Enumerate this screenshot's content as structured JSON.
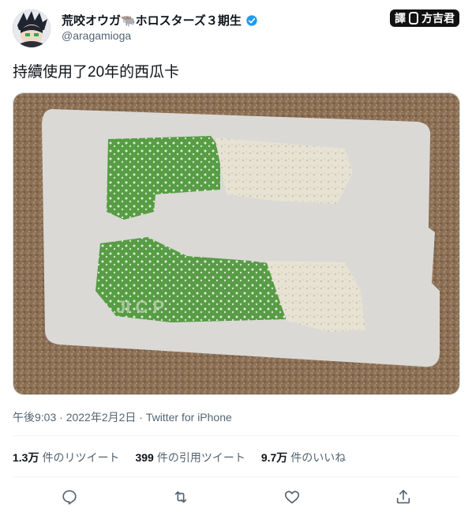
{
  "user": {
    "display_name": "荒咬オウガ🐃ホロスターズ３期生",
    "handle": "@aragamioga",
    "verified": true
  },
  "translator_badge": {
    "left": "譯",
    "right": "方吉君"
  },
  "tweet": {
    "text": "持續使用了20年的西瓜卡",
    "timestamp": "午後9:03 · 2022年2月2日 · Twitter for iPhone"
  },
  "stats": {
    "retweets_value": "1.3万",
    "retweets_label": "件のリツイート",
    "quotes_value": "399",
    "quotes_label": "件の引用ツイート",
    "likes_value": "9.7万",
    "likes_label": "件のいいね"
  },
  "colors": {
    "verified_blue": "#1d9bf0",
    "icon_gray": "#536471",
    "card_green": "#4f9a3b",
    "carpet": "#8a6f55"
  },
  "actions": [
    "reply-icon",
    "retweet-icon",
    "like-icon",
    "share-icon"
  ]
}
